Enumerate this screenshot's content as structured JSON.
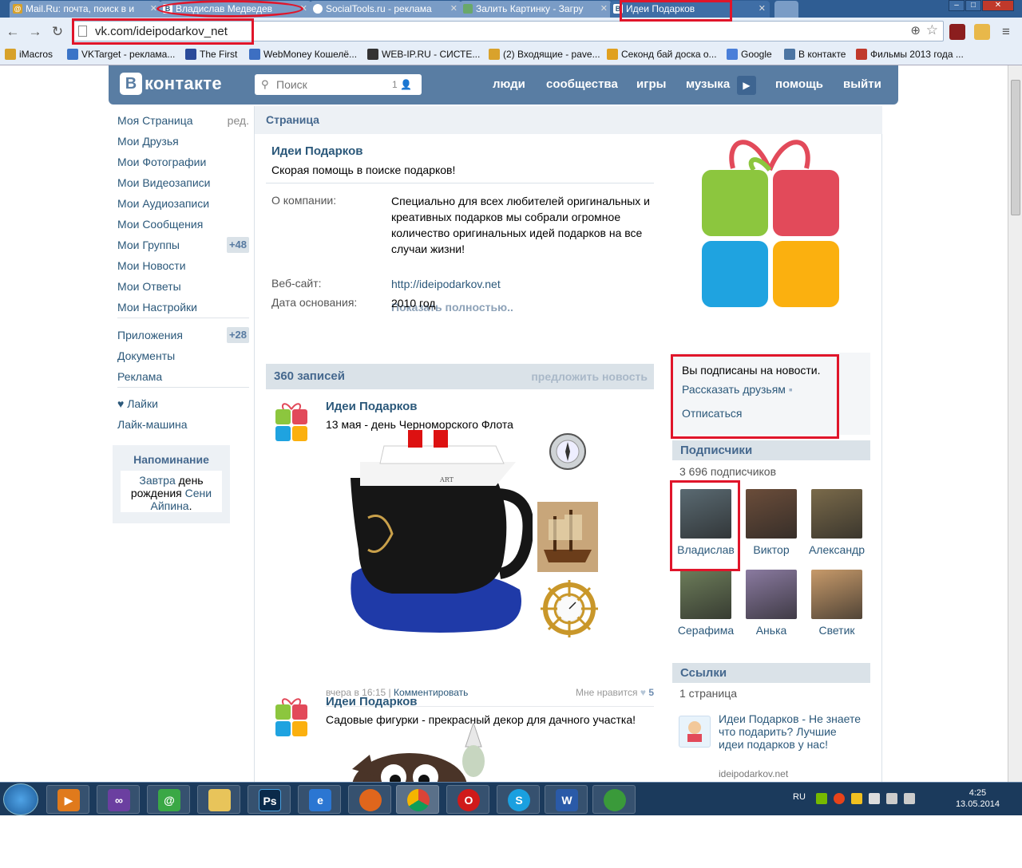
{
  "browser": {
    "tabs": [
      {
        "title": "Mail.Ru: почта, поиск в и",
        "icon": "at-icon"
      },
      {
        "title": "Владислав Медведев",
        "icon": "vk-icon"
      },
      {
        "title": "SocialTools.ru - реклама",
        "icon": "circle-icon"
      },
      {
        "title": "Залить Картинку - Загру",
        "icon": "image-icon"
      },
      {
        "title": "Идеи Подарков",
        "icon": "vk-icon"
      }
    ],
    "url": "vk.com/ideipodarkov_net",
    "bookmarks": [
      {
        "label": "iMacros",
        "color": "#d7a12a"
      },
      {
        "label": "VKTarget - реклама...",
        "color": "#3b74c7"
      },
      {
        "label": "The First",
        "color": "#2a4a9a"
      },
      {
        "label": "WebMoney Кошелё...",
        "color": "#3d6fc2"
      },
      {
        "label": "WEB-IP.RU - СИСТЕ...",
        "color": "#333333"
      },
      {
        "label": "(2) Входящие - pave...",
        "color": "#d9a22c"
      },
      {
        "label": "Секонд бай доска о...",
        "color": "#e0a020"
      },
      {
        "label": "Google",
        "color": "#4a7fd9"
      },
      {
        "label": "В контакте",
        "color": "#4c75a3"
      },
      {
        "label": "Фильмы 2013 года ...",
        "color": "#c0392b"
      }
    ]
  },
  "vk": {
    "logo_text": "контакте",
    "logo_letter": "В",
    "search_placeholder": "Поиск",
    "search_count": "1",
    "topnav": [
      "люди",
      "сообщества",
      "игры",
      "музыка",
      "помощь",
      "выйти"
    ],
    "leftnav": [
      {
        "label": "Моя Страница",
        "side": "ред."
      },
      {
        "label": "Мои Друзья"
      },
      {
        "label": "Мои Фотографии"
      },
      {
        "label": "Мои Видеозаписи"
      },
      {
        "label": "Мои Аудиозаписи"
      },
      {
        "label": "Мои Сообщения"
      },
      {
        "label": "Мои Группы",
        "badge": "+48"
      },
      {
        "label": "Мои Новости"
      },
      {
        "label": "Мои Ответы"
      },
      {
        "label": "Мои Настройки"
      }
    ],
    "leftnav2": [
      {
        "label": "Приложения",
        "badge": "+28"
      },
      {
        "label": "Документы"
      },
      {
        "label": "Реклама"
      }
    ],
    "leftnav3": [
      {
        "label": "♥ Лайки"
      },
      {
        "label": "Лайк-машина"
      }
    ],
    "reminder": {
      "title": "Напоминание",
      "w1": "Завтра",
      "w2": " день рождения ",
      "w3": "Сени Айпина",
      "w4": "."
    },
    "main": {
      "header": "Страница",
      "group_name": "Идеи Подарков",
      "group_status": "Скорая помощь в поиске подарков!",
      "about_label": "О компании:",
      "about_value": "Специально для всех любителей оригинальных и креативных подарков мы собрали огромное количество оригинальных идей подарков на все случаи жизни!",
      "show_more": "Показать полностью..",
      "site_label": "Веб-сайт:",
      "site_value": "http://ideipodarkov.net",
      "founded_label": "Дата основания:",
      "founded_value": "2010 год",
      "wall_count": "360 записей",
      "suggest": "предложить новость"
    },
    "posts": [
      {
        "author": "Идеи Подарков",
        "text": "13 мая - день Черноморского Флота",
        "time": "вчера в 16:15",
        "comment": "Комментировать",
        "like_label": "Мне нравится",
        "like_count": "5"
      },
      {
        "author": "Идеи Подарков",
        "text": "Садовые фигурки - прекрасный декор для дачного участка!"
      }
    ],
    "right": {
      "subscribed": "Вы подписаны на новости.",
      "tell_friends": "Рассказать друзьям",
      "unsubscribe": "Отписаться",
      "subscribers_title": "Подписчики",
      "subscribers_count": "3 696 подписчиков",
      "subscribers": [
        {
          "name": "Владислав",
          "color": "#5a6a72"
        },
        {
          "name": "Виктор",
          "color": "#6b4d3a"
        },
        {
          "name": "Александр",
          "color": "#7a6a4a"
        },
        {
          "name": "Серафима",
          "color": "#6d7d5a"
        },
        {
          "name": "Анька",
          "color": "#8a7aa0"
        },
        {
          "name": "Светик",
          "color": "#c79a6a"
        }
      ],
      "links_title": "Ссылки",
      "links_count": "1 страница",
      "link_title": "Идеи Подарков - Не знаете что подарить? Лучшие идеи подарков у нас!",
      "link_domain": "ideipodarkov.net"
    }
  },
  "taskbar": {
    "lang": "RU",
    "time": "4:25",
    "date": "13.05.2014"
  },
  "colors": {
    "vk_blue": "#597da3",
    "link": "#2b587a",
    "annotation_red": "#e0152a"
  }
}
